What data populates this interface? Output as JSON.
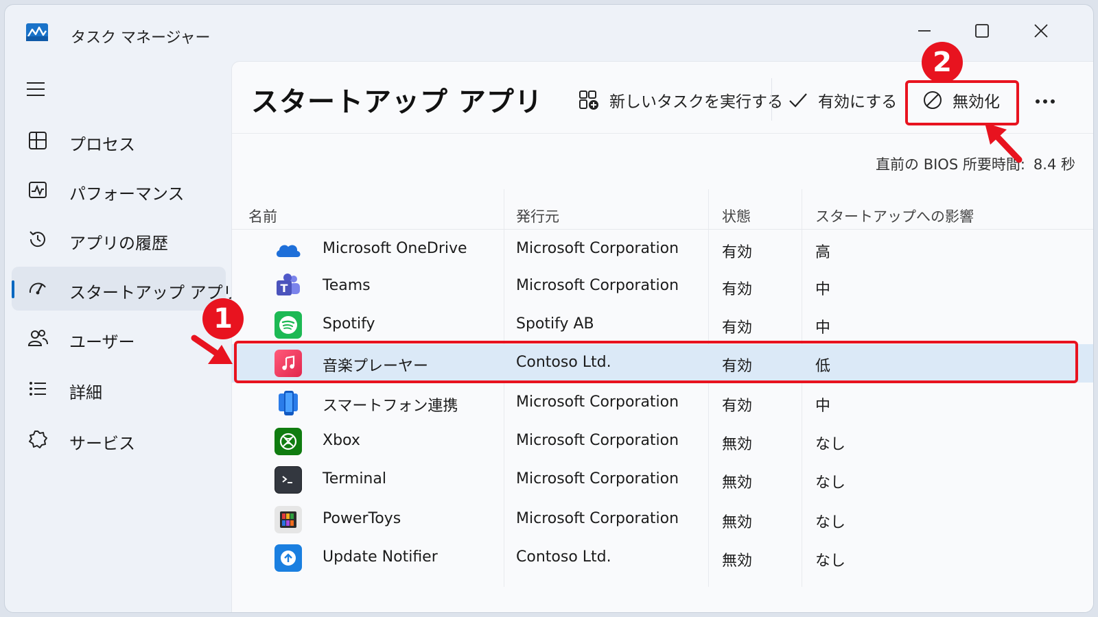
{
  "window": {
    "title": "タスク マネージャー"
  },
  "sidebar": {
    "items": [
      {
        "label": "プロセス",
        "icon": "processes-icon"
      },
      {
        "label": "パフォーマンス",
        "icon": "performance-icon"
      },
      {
        "label": "アプリの履歴",
        "icon": "history-icon"
      },
      {
        "label": "スタートアップ アプリ",
        "icon": "startup-icon",
        "active": true
      },
      {
        "label": "ユーザー",
        "icon": "users-icon"
      },
      {
        "label": "詳細",
        "icon": "details-icon"
      },
      {
        "label": "サービス",
        "icon": "services-icon"
      }
    ]
  },
  "page": {
    "title": "スタートアップ アプリ"
  },
  "toolbar": {
    "run_task_label": "新しいタスクを実行する",
    "enable_label": "有効にする",
    "disable_label": "無効化"
  },
  "bios": {
    "label": "直前の BIOS 所要時間:",
    "value": "8.4 秒"
  },
  "table": {
    "headers": [
      "名前",
      "発行元",
      "状態",
      "スタートアップへの影響"
    ],
    "rows": [
      {
        "name": "Microsoft OneDrive",
        "publisher": "Microsoft Corporation",
        "status": "有効",
        "impact": "高",
        "icon": "onedrive-icon"
      },
      {
        "name": "Teams",
        "publisher": "Microsoft Corporation",
        "status": "有効",
        "impact": "中",
        "icon": "teams-icon"
      },
      {
        "name": "Spotify",
        "publisher": "Spotify AB",
        "status": "有効",
        "impact": "中",
        "icon": "spotify-icon"
      },
      {
        "name": "音楽プレーヤー",
        "publisher": "Contoso Ltd.",
        "status": "有効",
        "impact": "低",
        "icon": "music-player-icon",
        "selected": true
      },
      {
        "name": "スマートフォン連携",
        "publisher": "Microsoft Corporation",
        "status": "有効",
        "impact": "中",
        "icon": "phone-link-icon"
      },
      {
        "name": "Xbox",
        "publisher": "Microsoft Corporation",
        "status": "無効",
        "impact": "なし",
        "icon": "xbox-icon"
      },
      {
        "name": "Terminal",
        "publisher": "Microsoft Corporation",
        "status": "無効",
        "impact": "なし",
        "icon": "terminal-icon"
      },
      {
        "name": "PowerToys",
        "publisher": "Microsoft Corporation",
        "status": "無効",
        "impact": "なし",
        "icon": "powertoys-icon"
      },
      {
        "name": "Update Notifier",
        "publisher": "Contoso Ltd.",
        "status": "無効",
        "impact": "なし",
        "icon": "update-notifier-icon"
      }
    ]
  },
  "annotations": {
    "badge1": "1",
    "badge2": "2",
    "color": "#e8131f"
  },
  "colors": {
    "accent": "#0067c0",
    "selection": "#dbe9f7",
    "highlight": "#e8131f"
  }
}
